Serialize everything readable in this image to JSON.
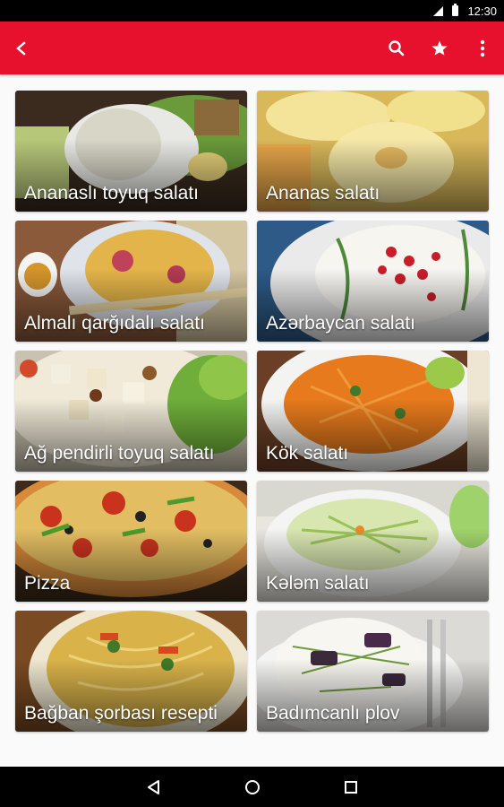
{
  "status_bar": {
    "time": "12:30"
  },
  "app_bar": {
    "back_icon": "arrow-back-icon",
    "search_icon": "search-icon",
    "favorite_icon": "star-icon",
    "menu_icon": "more-vert-icon",
    "color": "#e8112d"
  },
  "recipes": [
    {
      "title": "Ananaslı toyuq salatı"
    },
    {
      "title": "Ananas salatı"
    },
    {
      "title": "Almalı qarğıdalı salatı"
    },
    {
      "title": "Azərbaycan salatı"
    },
    {
      "title": "Ağ pendirli toyuq salatı"
    },
    {
      "title": "Kök salatı"
    },
    {
      "title": "Pizza"
    },
    {
      "title": "Kələm salatı"
    },
    {
      "title": "Bağban şorbası resepti"
    },
    {
      "title": "Badımcanlı plov"
    }
  ],
  "nav_bar": {
    "back": "back-triangle-icon",
    "home": "home-circle-icon",
    "recents": "recents-square-icon"
  }
}
